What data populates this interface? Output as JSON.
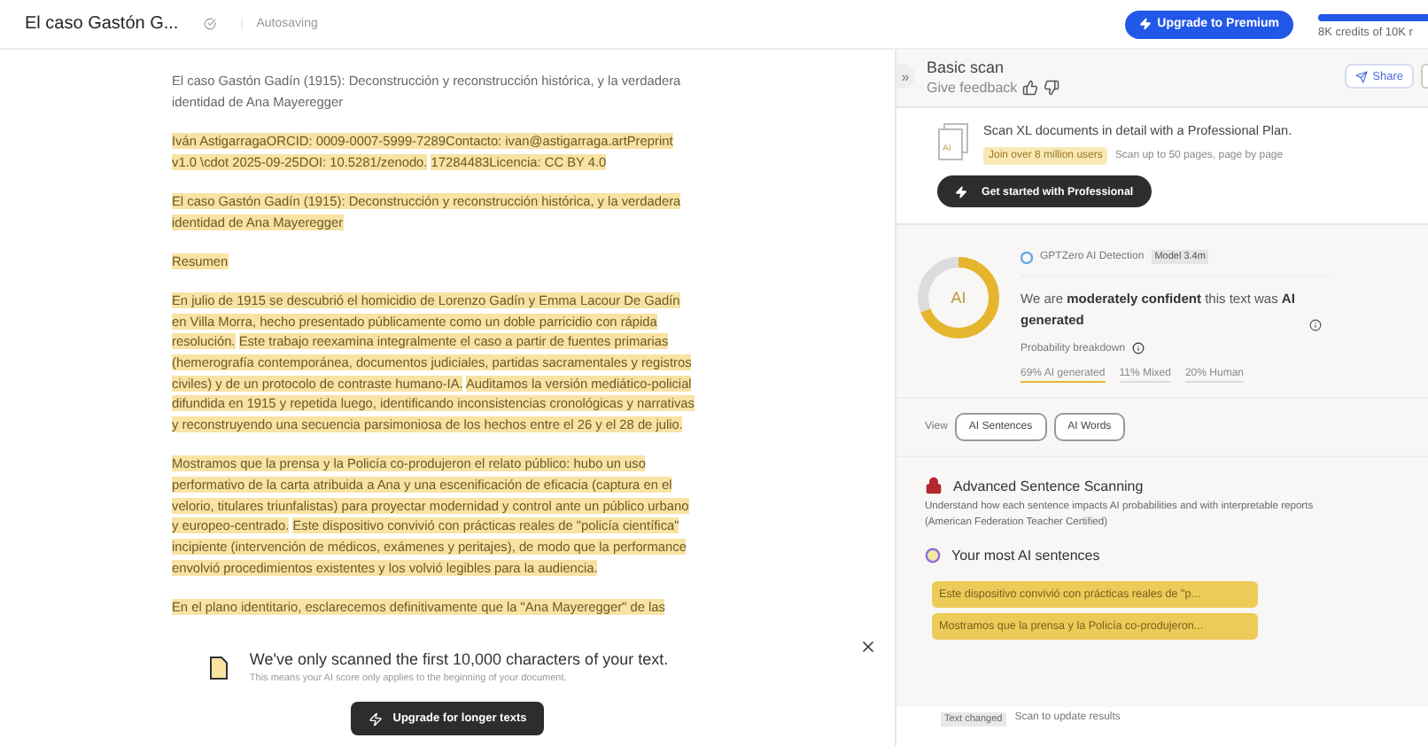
{
  "header": {
    "doc_title": "El caso Gastón G...",
    "save_status": "Autosaving",
    "upgrade_button": "Upgrade to Premium",
    "credits": {
      "label": "8K credits of 10K r",
      "level": 0.8
    }
  },
  "document": {
    "paragraphs": [
      {
        "segments": [
          {
            "text": "El caso Gastón Gadín (1915):  Deconstrucción y reconstrucción histórica, y la verdadera identidad de Ana Mayeregger",
            "highlighted": false
          }
        ]
      },
      {
        "segments": [
          {
            "text": "Iván AstigarragaORCID: 0009-0007-5999-7289Contacto: ivan@astigarraga.artPreprint v1.0 \\cdot 2025-09-25DOI: 10.5281/zenodo.",
            "highlighted": true
          },
          {
            "text": "17284483Licencia: CC BY 4.0",
            "highlighted": true
          }
        ]
      },
      {
        "segments": [
          {
            "text": "El caso Gastón Gadín (1915): Deconstrucción y reconstrucción histórica, y la verdadera identidad de Ana Mayeregger",
            "highlighted": true
          }
        ]
      },
      {
        "segments": [
          {
            "text": "Resumen",
            "highlighted": true
          }
        ]
      },
      {
        "segments": [
          {
            "text": "En julio de 1915 se descubrió el homicidio de Lorenzo Gadín y Emma Lacour De Gadín en Villa Morra, hecho presentado públicamente como un doble parricidio con rápida resolución.",
            "highlighted": true
          },
          {
            "text": "Este trabajo reexamina integralmente el caso a partir de fuentes primarias (hemerografía contemporánea, documentos judiciales, partidas sacramentales y registros civiles) y de un protocolo de contraste humano-IA.",
            "highlighted": true
          },
          {
            "text": "Auditamos la versión mediático-policial difundida en 1915 y repetida luego, identificando inconsistencias cronológicas y narrativas y reconstruyendo una secuencia parsimoniosa de los hechos entre el 26 y el 28 de julio.",
            "highlighted": true
          }
        ]
      },
      {
        "segments": [
          {
            "text": "Mostramos que la prensa y la Policía co-produjeron el relato público: hubo un uso performativo de la carta atribuida a Ana y una escenificación de eficacia (captura en el velorio, titulares triunfalistas) para proyectar modernidad y control ante un público urbano y europeo-centrado.",
            "highlighted": true
          },
          {
            "text": "Este dispositivo convivió con prácticas reales de \"policía científica\" incipiente (intervención de médicos, exámenes y peritajes), de modo que la performance envolvió procedimientos existentes y los volvió legibles para la audiencia.",
            "highlighted": true
          }
        ]
      },
      {
        "segments": [
          {
            "text": "En el plano identitario, esclarecemos definitivamente que la \"Ana Mayeregger\" de las",
            "highlighted": true
          }
        ]
      }
    ]
  },
  "limit_banner": {
    "title": "We've only scanned the first 10,000 characters of your text.",
    "subtitle": "This means your AI score only applies to the beginning of your document.",
    "button": "Upgrade for longer texts"
  },
  "panel": {
    "collapse": "»",
    "title": "Basic scan",
    "feedback": "Give feedback",
    "share": "Share",
    "promo": {
      "title": "Scan XL documents in detail with a Professional Plan.",
      "badge": "Join over 8 million users",
      "note": "Scan up to 50 pages, page by page",
      "button": "Get started with Professional",
      "icon_label": "AI"
    },
    "result": {
      "donut_label": "AI",
      "source": "GPTZero AI Detection",
      "model": "Model 3.4m",
      "statement": "We are **moderately confident** this text was **AI generated**",
      "breakdown_title": "Probability breakdown",
      "breakdown": [
        {
          "label": "69% AI generated",
          "level": 0.69,
          "color": "#e5b52e"
        },
        {
          "label": "11% Mixed",
          "level": 0.11,
          "color": "#dcdcdc"
        },
        {
          "label": "20% Human",
          "level": 0.2,
          "color": "#dcdcdc"
        }
      ]
    },
    "view": {
      "label": "View",
      "options": [
        {
          "label": "AI Sentences"
        },
        {
          "label": "AI Words"
        }
      ]
    },
    "advanced": {
      "title": "Advanced Sentence Scanning",
      "description": "Understand how each sentence impacts AI probabilities and with interpretable reports (American Federation Teacher Certified)",
      "list_title": "Your most AI sentences",
      "sentences": [
        "Este dispositivo convivió con prácticas reales de \"p...",
        "Mostramos que la prensa y la Policía co-produjeron..."
      ]
    },
    "status": {
      "badge": "Text changed",
      "note": "Scan to update results"
    }
  }
}
